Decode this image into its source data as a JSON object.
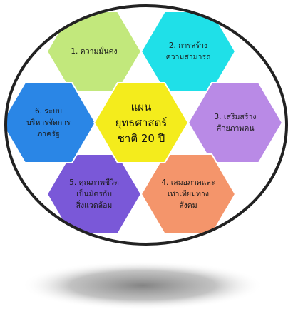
{
  "center": {
    "label": "แผน\nยุทธศาสตร์\nชาติ 20 ปี",
    "color": "#f4ec1c"
  },
  "strategies": [
    {
      "label": "1. ความมั่นคง",
      "color": "#c2e87c"
    },
    {
      "label": "2. การสร้าง\nความสามารถ",
      "color": "#1fe0e8"
    },
    {
      "label": "3. เสริมสร้าง\nศักยภาพคน",
      "color": "#b98ae6"
    },
    {
      "label": "4. เสมอภาคและ\nเท่าเทียมทาง\nสังคม",
      "color": "#f4956b"
    },
    {
      "label": "5. คุณภาพชีวิต\nเป็นมิตรกับ\nสิ่งแวดล้อม",
      "color": "#7a58d8"
    },
    {
      "label": "6. ระบบ\nบริหารจัดการ\nภาครัฐ",
      "color": "#2a86e6"
    }
  ],
  "frame": {
    "ring_color": "#222222",
    "shadow_color": "#8e8e8e"
  }
}
